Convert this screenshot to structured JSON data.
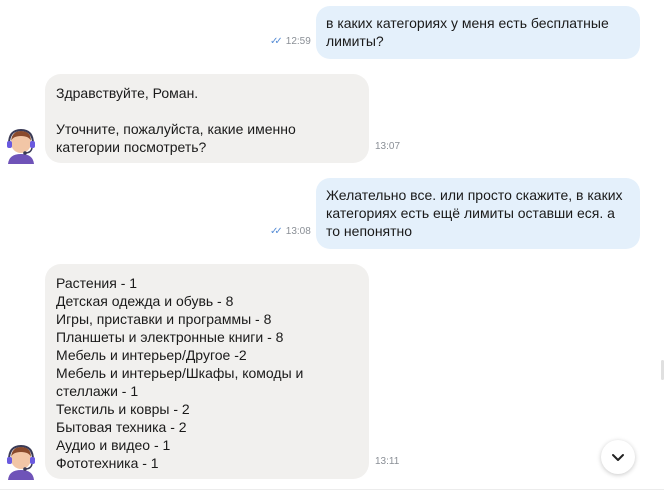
{
  "messages": [
    {
      "direction": "out",
      "text": "в каких категориях у меня есть бесплатные\nлимиты?",
      "time": "12:59",
      "read_icon": "double-check-icon"
    },
    {
      "direction": "in",
      "text": "Здравствуйте, Роман.\n\nУточните, пожалуйста, какие именно\nкатегории посмотреть?",
      "time": "13:07",
      "avatar_icon": "support-agent-avatar"
    },
    {
      "direction": "out",
      "text": "Желательно все. или просто скажите, в каких\nкатегориях есть ещё лимиты оставши еся. а\nто непонятно",
      "time": "13:08",
      "read_icon": "double-check-icon"
    },
    {
      "direction": "in",
      "text": "Растения - 1\nДетская одежда и обувь - 8\nИгры, приставки и программы - 8\nПланшеты и электронные книги - 8\nМебель и интерьер/Другое -2\nМебель и интерьер/Шкафы, комоды и\nстеллажи - 1\nТекстиль и ковры - 2\nБытовая техника - 2\nАудио и видео - 1\nФототехника - 1",
      "time": "13:11",
      "avatar_icon": "support-agent-avatar"
    }
  ],
  "scroll_button_icon": "chevron-down-icon",
  "colors": {
    "outgoing_bubble": "#e4f0fb",
    "incoming_bubble": "#f1f0ee",
    "read_check": "#5a8fd6",
    "timestamp": "#8a8f96"
  }
}
